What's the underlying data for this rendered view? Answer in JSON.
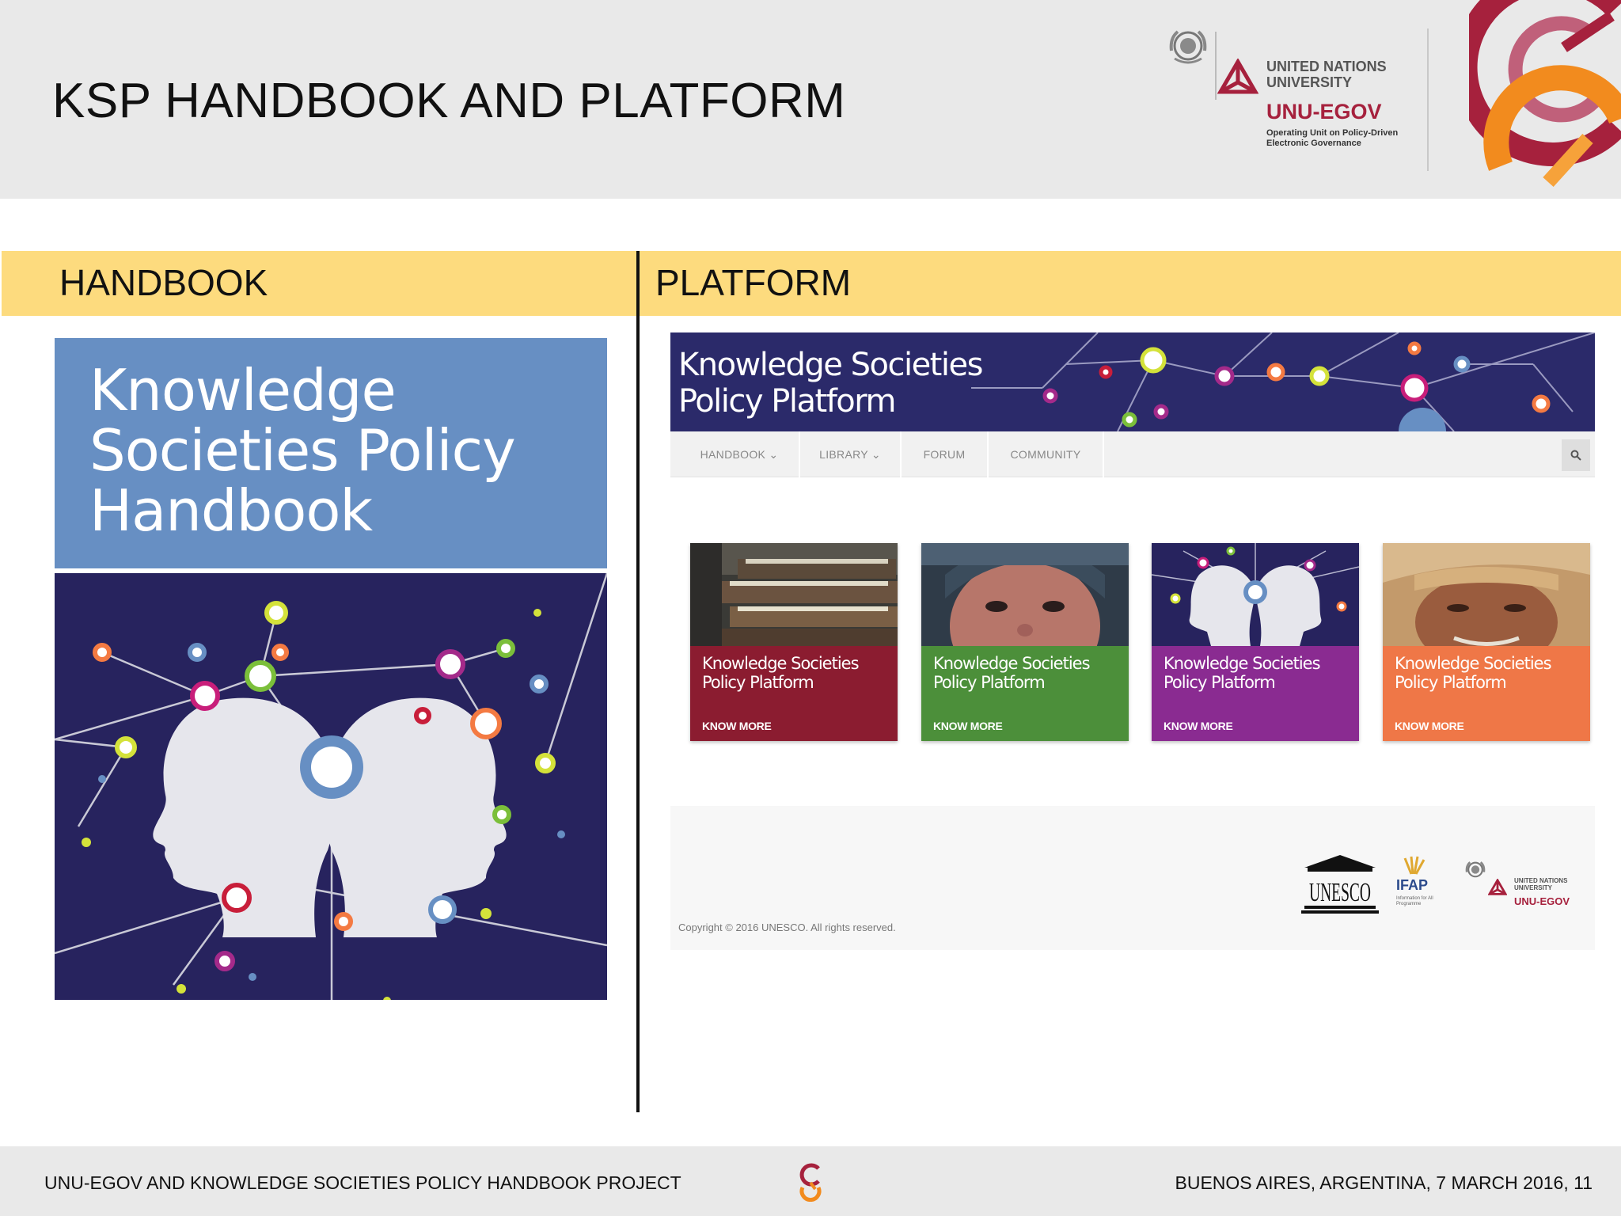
{
  "header": {
    "title": "KSP HANDBOOK AND PLATFORM",
    "un_logo": "un-emblem-icon",
    "unu_name_line1": "UNITED NATIONS",
    "unu_name_line2": "UNIVERSITY",
    "egov_name": "UNU-EGOV",
    "egov_sub_line1": "Operating Unit on Policy-Driven",
    "egov_sub_line2": "Electronic Governance",
    "accent_colors": [
      "#a6213d",
      "#f28b1e",
      "#c0607a"
    ]
  },
  "sections": {
    "left_label": "HANDBOOK",
    "right_label": "PLATFORM",
    "bar_color": "#fddb7e"
  },
  "handbook_cover": {
    "title_line1": "Knowledge",
    "title_line2": "Societies Policy",
    "title_line3": "Handbook",
    "top_color": "#678fc3",
    "art_color": "#27235e"
  },
  "platform_site": {
    "banner_title_line1": "Knowledge Societies",
    "banner_title_line2": "Policy Platform",
    "nav": [
      {
        "label": "HANDBOOK ⌄"
      },
      {
        "label": "LIBRARY ⌄"
      },
      {
        "label": "FORUM"
      },
      {
        "label": "COMMUNITY"
      }
    ],
    "search_icon": "search-icon",
    "cards": [
      {
        "title_line1": "Knowledge Societies",
        "title_line2": "Policy Platform",
        "cta": "KNOW MORE",
        "color": "#8b1c30",
        "image": "books"
      },
      {
        "title_line1": "Knowledge Societies",
        "title_line2": "Policy Platform",
        "cta": "KNOW MORE",
        "color": "#4c8f3a",
        "image": "child-portrait"
      },
      {
        "title_line1": "Knowledge Societies",
        "title_line2": "Policy Platform",
        "cta": "KNOW MORE",
        "color": "#8a2b91",
        "image": "heads-network"
      },
      {
        "title_line1": "Knowledge Societies",
        "title_line2": "Policy Platform",
        "cta": "KNOW MORE",
        "color": "#ef7747",
        "image": "elder-portrait"
      }
    ],
    "copyright": "Copyright © 2016 UNESCO. All rights reserved.",
    "footer_logos": {
      "unesco": "UNESCO",
      "ifap": "IFAP",
      "ifap_sub": "Information for All Programme",
      "unu_line1": "UNITED NATIONS",
      "unu_line2": "UNIVERSITY",
      "egov": "UNU-EGOV"
    }
  },
  "footer": {
    "left_text": "UNU-EGOV AND KNOWLEDGE SOCIETIES POLICY HANDBOOK PROJECT",
    "right_text": "BUENOS AIRES, ARGENTINA, 7 MARCH 2016, 11",
    "logo": "egov-logo-icon"
  }
}
